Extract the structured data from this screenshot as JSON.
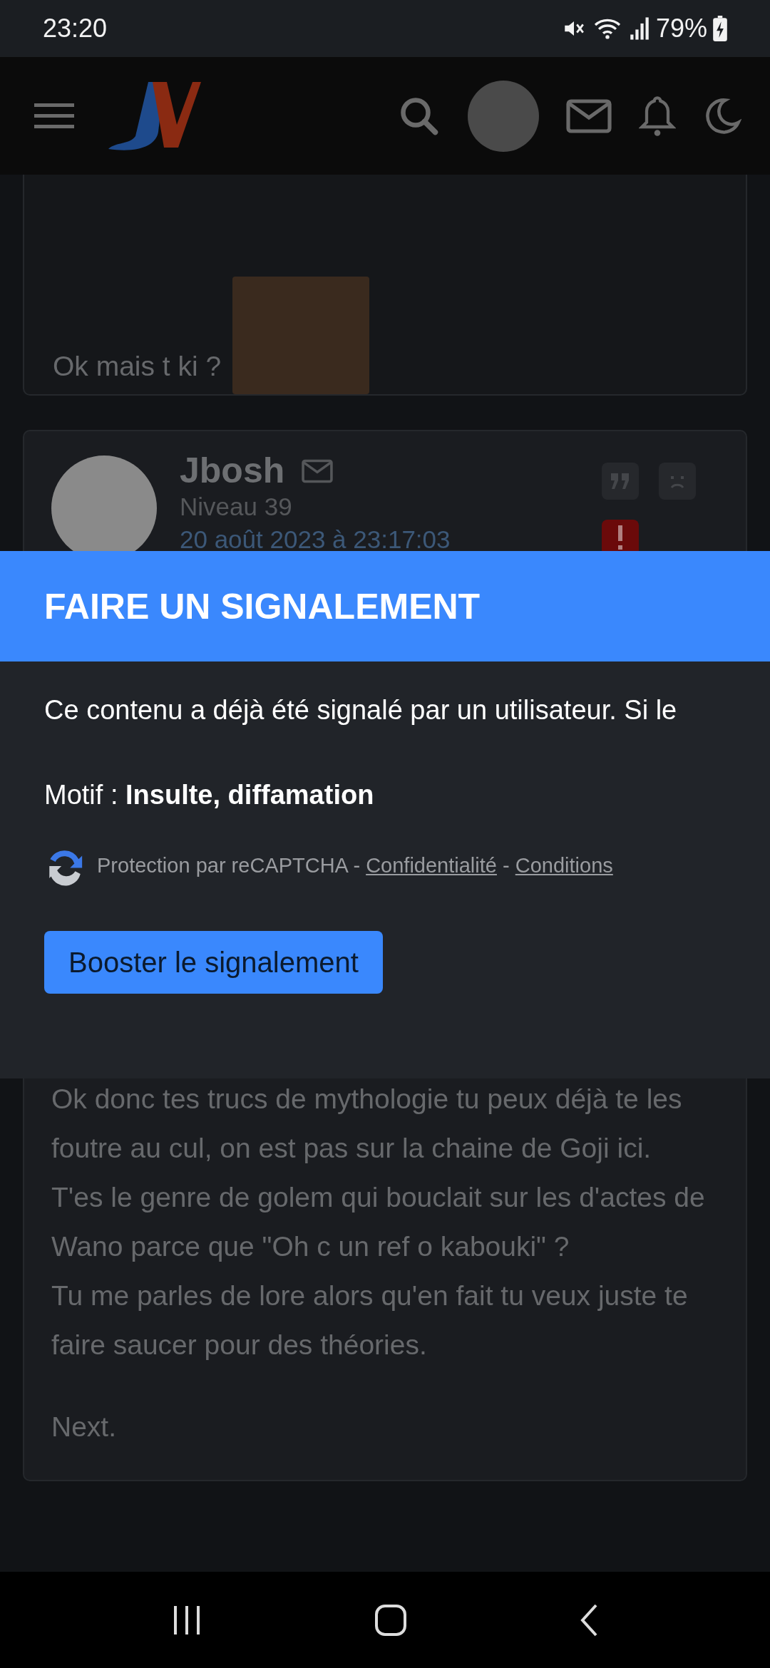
{
  "status_bar": {
    "time": "23:20",
    "battery": "79%"
  },
  "posts": [
    {
      "kind": "sticker",
      "text": "Ok mais t ki ?"
    },
    {
      "kind": "full",
      "author": "Jbosh",
      "rank": "Niveau 39",
      "date": "20 août 2023 à 23:17:03",
      "blocks": [
        {
          "lines": [
            "Ok donc tes trucs de mythologie tu peux déjà te les foutre au cul, on est pas sur la chaine de Goji ici.",
            "T'es le genre de golem qui bouclait sur les d'actes de Wano parce que \"Oh c un ref o kabouki\" ?",
            "Tu me parles de lore alors qu'en fait tu veux juste te faire saucer pour des théories."
          ]
        },
        {
          "lines": [
            "Next."
          ]
        }
      ]
    }
  ],
  "modal": {
    "title": "FAIRE UN SIGNALEMENT",
    "message": "Ce contenu a déjà été signalé par un utilisateur. Si le",
    "reason": "Motif : **Insulte, diffamation**",
    "captcha": [
      {
        "kind": "text",
        "text": "Protection par reCAPTCHA -"
      },
      {
        "kind": "link",
        "text": "Confidentialité"
      },
      {
        "kind": "text",
        "text": "-"
      },
      {
        "kind": "link",
        "text": "Conditions"
      }
    ],
    "button": "Booster le signalement"
  }
}
